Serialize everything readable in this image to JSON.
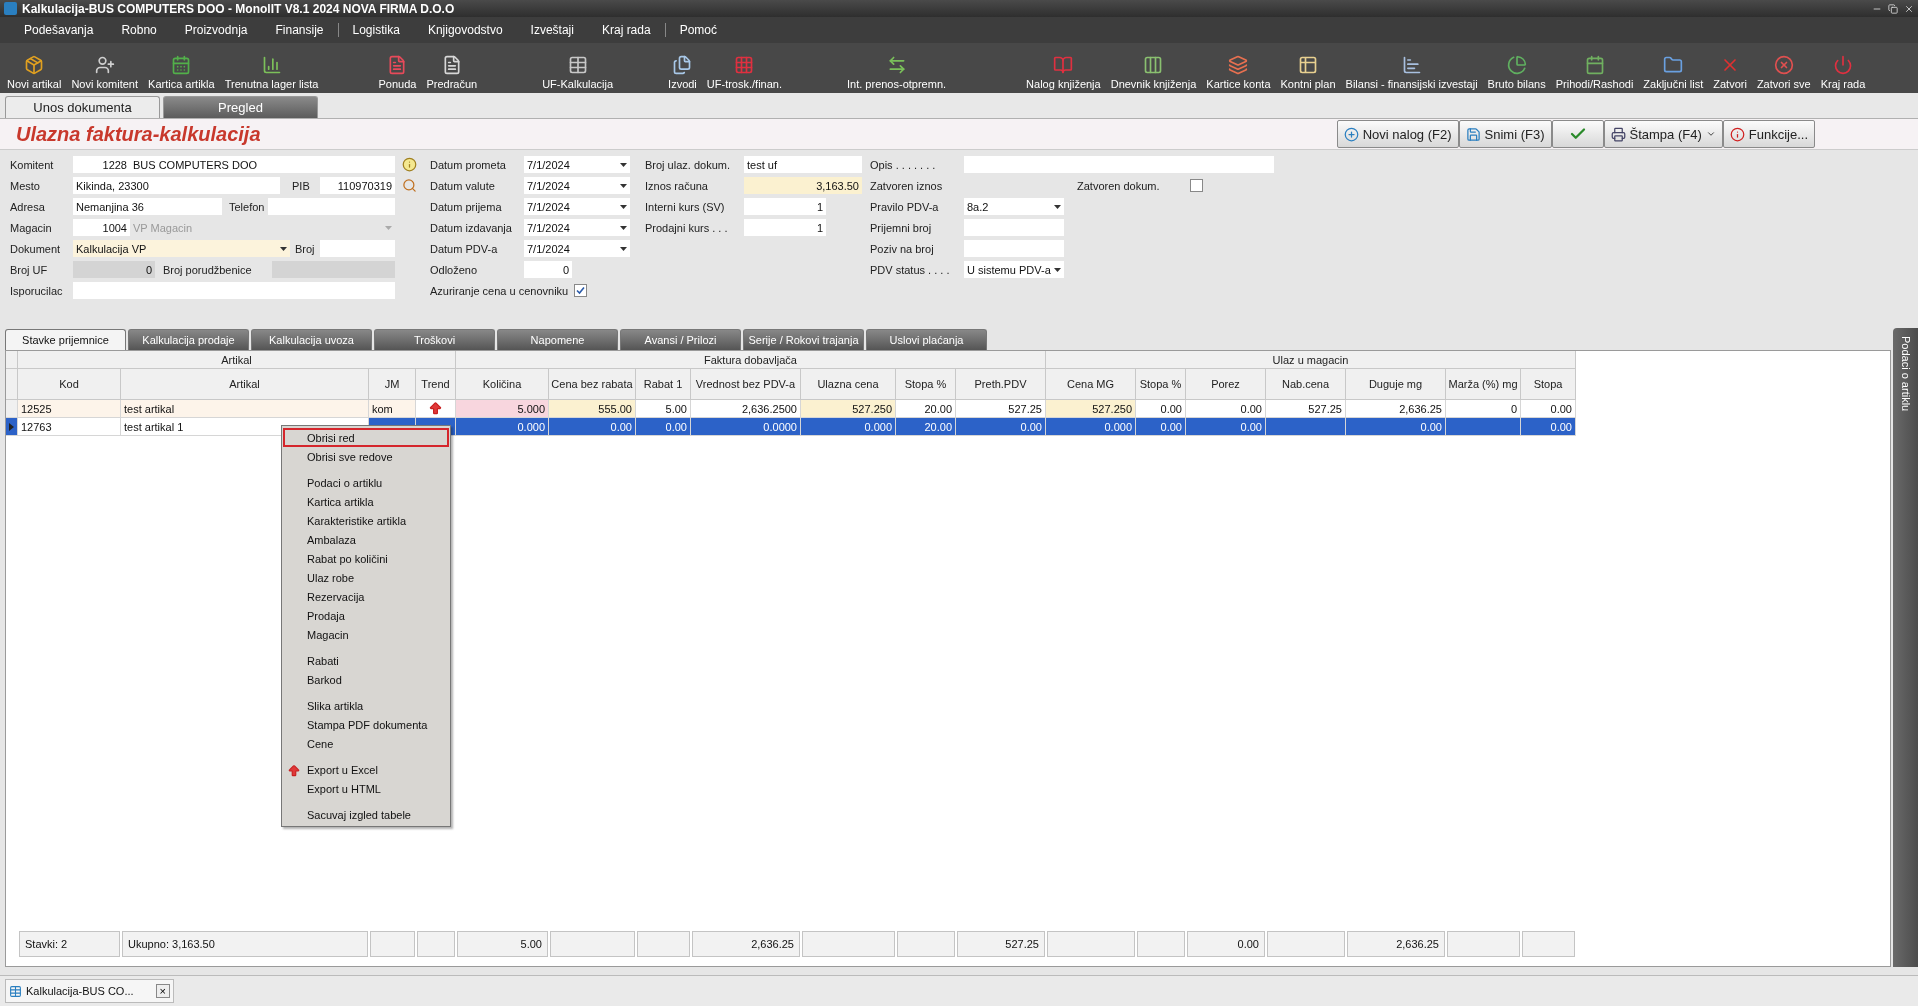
{
  "window": {
    "title": "Kalkulacija-BUS COMPUTERS DOO - MonolIT V8.1 2024 NOVA FIRMA D.O.O"
  },
  "menu": [
    {
      "label": "Podešavanja",
      "separator_before": false
    },
    {
      "label": "Robno",
      "separator_before": false
    },
    {
      "label": "Proizvodnja",
      "separator_before": false
    },
    {
      "label": "Finansije",
      "separator_before": false
    },
    {
      "label": "Logistika",
      "separator_before": true
    },
    {
      "label": "Knjigovodstvo",
      "separator_before": false
    },
    {
      "label": "Izveštaji",
      "separator_before": false
    },
    {
      "label": "Kraj rada",
      "separator_before": false
    },
    {
      "label": "Pomoć",
      "separator_before": true
    }
  ],
  "toolbar": [
    "Novi artikal",
    "Novi komitent",
    "Kartica artikla",
    "Trenutna lager lista",
    "Ponuda",
    "Predračun",
    "UF-Kalkulacija",
    "Izvodi",
    "UF-trosk./finan.",
    "Int. prenos-otpremn.",
    "Nalog knjiženja",
    "Dnevnik knjiženja",
    "Kartice konta",
    "Kontni plan",
    "Bilansi - finansijski izvestaji",
    "Bruto bilans",
    "Prihodi/Rashodi",
    "Zaključni list",
    "Zatvori",
    "Zatvori sve",
    "Kraj rada"
  ],
  "document_tabs": [
    {
      "label": "Unos dokumenta",
      "selected": true
    },
    {
      "label": "Pregled",
      "selected": false
    }
  ],
  "header": {
    "title": "Ulazna faktura-kalkulacija",
    "buttons": [
      {
        "kind": "new",
        "label": "Novi nalog (F2)"
      },
      {
        "kind": "save",
        "label": "Snimi (F3)"
      },
      {
        "kind": "confirm"
      },
      {
        "kind": "print",
        "label": "Štampa (F4)"
      },
      {
        "kind": "functions",
        "label": "Funkcije..."
      }
    ]
  },
  "form": {
    "columns": [
      [
        {
          "label": "Komitent",
          "fields": [
            {
              "kind": "number",
              "value": "1228"
            },
            {
              "kind": "text",
              "value": "BUS COMPUTERS DOO"
            },
            {
              "kind": "info-button"
            }
          ]
        },
        {
          "label": "Mesto",
          "fields": [
            {
              "kind": "text",
              "value": "Kikinda, 23300"
            },
            {
              "kind": "label",
              "text": "PIB"
            },
            {
              "kind": "number",
              "value": "110970319"
            },
            {
              "kind": "search-button"
            }
          ]
        },
        {
          "label": "Adresa",
          "fields": [
            {
              "kind": "text",
              "value": "Nemanjina 36"
            },
            {
              "kind": "label",
              "text": "Telefon"
            },
            {
              "kind": "text"
            }
          ]
        },
        {
          "label": "Magacin",
          "fields": [
            {
              "kind": "number",
              "value": "1004"
            },
            {
              "kind": "disabled-select",
              "value": "VP Magacin"
            }
          ]
        },
        {
          "label": "Dokument",
          "fields": [
            {
              "kind": "cream-select",
              "value": "Kalkulacija VP"
            },
            {
              "kind": "label",
              "text": "Broj"
            },
            {
              "kind": "text"
            }
          ]
        },
        {
          "label": "Broj UF",
          "fields": [
            {
              "kind": "number-readonly",
              "value": "0"
            },
            {
              "kind": "label",
              "text": "Broj porudžbenice"
            },
            {
              "kind": "readonly"
            }
          ]
        },
        {
          "label": "Isporucilac",
          "fields": [
            {
              "kind": "text"
            },
            {
              "kind": "text"
            }
          ]
        }
      ],
      [
        {
          "label": "Datum prometa",
          "fields": [
            {
              "kind": "select",
              "value": "7/1/2024"
            }
          ]
        },
        {
          "label": "Datum valute",
          "fields": [
            {
              "kind": "select",
              "value": "7/1/2024"
            }
          ]
        },
        {
          "label": "Datum prijema",
          "fields": [
            {
              "kind": "select",
              "value": "7/1/2024"
            }
          ]
        },
        {
          "label": "Datum izdavanja",
          "fields": [
            {
              "kind": "select",
              "value": "7/1/2024"
            }
          ]
        },
        {
          "label": "Datum PDV-a",
          "fields": [
            {
              "kind": "select",
              "value": "7/1/2024"
            }
          ]
        },
        {
          "label": "Odloženo",
          "fields": [
            {
              "kind": "number",
              "value": "0"
            }
          ]
        },
        {
          "label": "Azuriranje cena u cenovniku",
          "fields": [
            {
              "kind": "checkbox",
              "checked": true
            }
          ]
        }
      ],
      [
        {
          "label": "Broj ulaz. dokum.",
          "fields": [
            {
              "kind": "text",
              "value": "test uf"
            }
          ]
        },
        {
          "label": "Iznos računa",
          "fields": [
            {
              "kind": "number-highlight",
              "value": "3,163.50"
            }
          ]
        },
        {
          "label": "Interni kurs (SV)",
          "fields": [
            {
              "kind": "number",
              "value": "1"
            }
          ]
        },
        {
          "label": "Prodajni kurs . . .",
          "fields": [
            {
              "kind": "number",
              "value": "1"
            }
          ]
        }
      ],
      [
        {
          "label": "Opis . . . . . . .",
          "fields": [
            {
              "kind": "text"
            }
          ]
        },
        {
          "label": "Zatvoren iznos",
          "fields": [
            {
              "kind": "label",
              "text": "Zatvoren dokum."
            },
            {
              "kind": "checkbox",
              "checked": false
            }
          ]
        },
        {
          "label": "Pravilo PDV-a",
          "fields": [
            {
              "kind": "select",
              "value": "8a.2"
            }
          ]
        },
        {
          "label": "Prijemni broj",
          "fields": [
            {
              "kind": "text"
            }
          ]
        },
        {
          "label": "Poziv na broj",
          "fields": [
            {
              "kind": "text"
            }
          ]
        },
        {
          "label": "PDV status . . . .",
          "fields": [
            {
              "kind": "select",
              "value": "U sistemu PDV-a"
            }
          ]
        }
      ]
    ]
  },
  "inner_tabs": [
    {
      "label": "Stavke  prijemnice",
      "selected": true
    },
    {
      "label": "Kalkulacija prodaje",
      "selected": false
    },
    {
      "label": "Kalkulacija uvoza",
      "selected": false
    },
    {
      "label": "Troškovi",
      "selected": false
    },
    {
      "label": "Napomene",
      "selected": false
    },
    {
      "label": "Avansi / Prilozi",
      "selected": false
    },
    {
      "label": "Serije / Rokovi trajanja",
      "selected": false
    },
    {
      "label": "Uslovi plaćanja",
      "selected": false
    }
  ],
  "side_tab": "Podaci o artiklu",
  "table": {
    "groups": [
      "Artikal",
      "Faktura dobavljača",
      "Ulaz u magacin"
    ],
    "columns": [
      "Kod",
      "Artikal",
      "JM",
      "Trend",
      "Količina",
      "Cena bez rabata",
      "Rabat 1",
      "Vrednost bez PDV-a",
      "Ulazna cena",
      "Stopa %",
      "Preth.PDV",
      "Cena MG",
      "Stopa %",
      "Porez",
      "Nab.cena",
      "Duguje mg",
      "Marža (%) mg",
      "Stopa"
    ],
    "rows": [
      {
        "selected": false,
        "trend_up": true,
        "cells": [
          "12525",
          "test artikal",
          "kom",
          null,
          "5.000",
          "555.00",
          "5.00",
          "2,636.2500",
          "527.250",
          "20.00",
          "527.25",
          "527.250",
          "0.00",
          "0.00",
          "527.25",
          "2,636.25",
          "0",
          "0.00"
        ]
      },
      {
        "selected": true,
        "trend_up": false,
        "cells": [
          "12763",
          "test artikal 1",
          null,
          null,
          "0.000",
          "0.00",
          "0.00",
          "0.0000",
          "0.000",
          "20.00",
          "0.00",
          "0.000",
          "0.00",
          "0.00",
          null,
          "0.00",
          null,
          "0.00"
        ]
      }
    ],
    "footer": [
      "Stavki: 2",
      "Ukupno:  3,163.50",
      "5.00",
      "2,636.25",
      "527.25",
      "0.00",
      "2,636.25"
    ]
  },
  "context_menu": [
    {
      "label": "Obrisi red",
      "selected": true,
      "separator_before": false,
      "icon": false
    },
    {
      "label": "Obrisi sve redove",
      "selected": false,
      "separator_before": false,
      "icon": false
    },
    {
      "label": "Podaci o artiklu",
      "selected": false,
      "separator_before": true,
      "icon": false
    },
    {
      "label": "Kartica artikla",
      "selected": false,
      "separator_before": false,
      "icon": false
    },
    {
      "label": "Karakteristike artikla",
      "selected": false,
      "separator_before": false,
      "icon": false
    },
    {
      "label": "Ambalaza",
      "selected": false,
      "separator_before": false,
      "icon": false
    },
    {
      "label": "Rabat po količini",
      "selected": false,
      "separator_before": false,
      "icon": false
    },
    {
      "label": "Ulaz robe",
      "selected": false,
      "separator_before": false,
      "icon": false
    },
    {
      "label": "Rezervacija",
      "selected": false,
      "separator_before": false,
      "icon": false
    },
    {
      "label": "Prodaja",
      "selected": false,
      "separator_before": false,
      "icon": false
    },
    {
      "label": "Magacin",
      "selected": false,
      "separator_before": false,
      "icon": false
    },
    {
      "label": "Rabati",
      "selected": false,
      "separator_before": true,
      "icon": false
    },
    {
      "label": "Barkod",
      "selected": false,
      "separator_before": false,
      "icon": false
    },
    {
      "label": "Slika artikla",
      "selected": false,
      "separator_before": true,
      "icon": false
    },
    {
      "label": "Stampa PDF dokumenta",
      "selected": false,
      "separator_before": false,
      "icon": false
    },
    {
      "label": "Cene",
      "selected": false,
      "separator_before": false,
      "icon": false
    },
    {
      "label": "Export u Excel",
      "selected": false,
      "separator_before": true,
      "icon": true
    },
    {
      "label": "Export u HTML",
      "selected": false,
      "separator_before": false,
      "icon": false
    },
    {
      "label": "Sacuvaj izgled tabele",
      "selected": false,
      "separator_before": true,
      "icon": false
    }
  ],
  "taskbar": {
    "label": "Kalkulacija-BUS CO...",
    "close": "×"
  }
}
